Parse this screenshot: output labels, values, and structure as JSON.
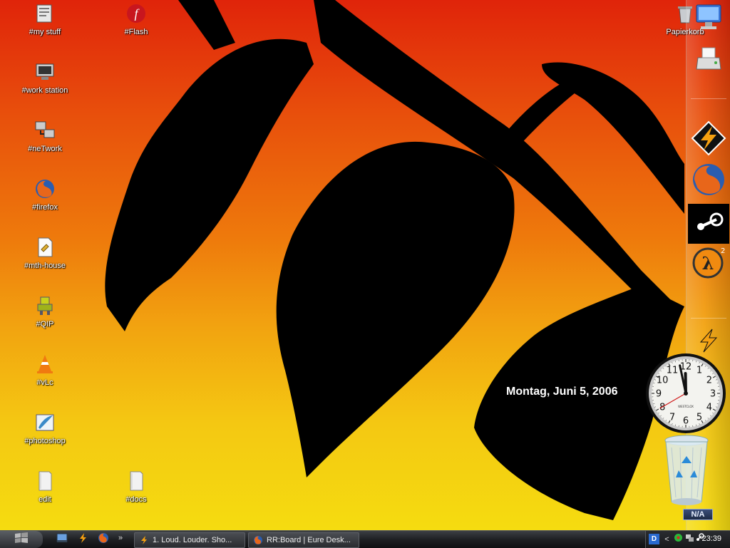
{
  "desktop": {
    "icons": [
      {
        "label": "#my stuff",
        "icon": "my-stuff-icon"
      },
      {
        "label": "#work station",
        "icon": "workstation-icon"
      },
      {
        "label": "#neTwork",
        "icon": "network-icon"
      },
      {
        "label": "#firefox",
        "icon": "firefox-icon"
      },
      {
        "label": "#mth-house",
        "icon": "document-icon"
      },
      {
        "label": "#QIP",
        "icon": "qip-icon"
      },
      {
        "label": "#vLc",
        "icon": "vlc-icon"
      },
      {
        "label": "#photoshop",
        "icon": "photoshop-icon"
      },
      {
        "label": "edit",
        "icon": "folder-icon"
      },
      {
        "label": "#Flash",
        "icon": "flash-icon"
      },
      {
        "label": "#docs",
        "icon": "folder-icon"
      },
      {
        "label": "Papierkorb",
        "icon": "recycle-bin-icon"
      }
    ]
  },
  "dock": {
    "items": [
      "my-computer-icon",
      "printer-icon",
      "winamp-icon",
      "firefox-icon",
      "steam-icon",
      "half-life-2-icon",
      "winamp-icon"
    ]
  },
  "widgets": {
    "date": "Montag, Juni 5, 2006",
    "clock": {
      "brand": "WESTCLOX",
      "hour": 11,
      "minute": 58,
      "second": 40
    },
    "recycle_bin_badge": "N/A"
  },
  "taskbar": {
    "quick_launch": [
      "show-desktop-icon",
      "winamp-icon",
      "firefox-icon"
    ],
    "more": "»",
    "tasks": [
      {
        "label": "1. Loud. Louder. Sho...",
        "icon": "winamp-icon"
      },
      {
        "label": "RR:Board | Eure Desk...",
        "icon": "firefox-icon"
      }
    ],
    "tray": {
      "language": "D",
      "arrow": "<",
      "time": "23:39"
    }
  },
  "colors": {
    "sky_top": "#e0240a",
    "sky_bottom": "#f5dc10",
    "silhouette": "#000000",
    "taskbar": "#1e2023"
  }
}
